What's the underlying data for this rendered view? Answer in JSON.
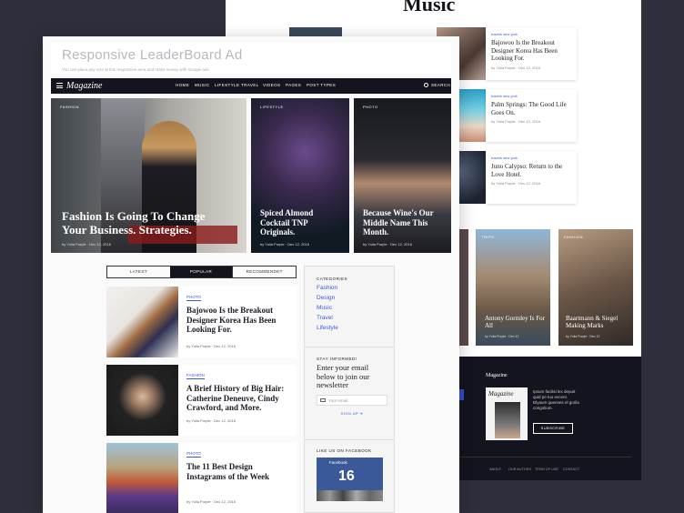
{
  "back": {
    "heading": "Music",
    "cards": [
      {
        "tag": "travels new york",
        "title": "Bajowoo Is the Breakout Designer Korea Has Been Looking For.",
        "meta": "by Yulia Purple · Dec 12, 2016"
      },
      {
        "tag": "travels new york",
        "title": "Palm Springs: The Good Life Goes On.",
        "meta": "by Yulia Purple · Dec 12, 2016"
      },
      {
        "tag": "travels new york",
        "title": "Juno Calypso: Return to the Love Hotel.",
        "meta": "by Yulia Purple · Dec 12, 2016"
      }
    ],
    "columns": [
      {
        "label": "TRIPS",
        "title": "Antony Gormley Is For All",
        "meta": "by Yulia Purple · Dec 12"
      },
      {
        "label": "FASHION",
        "title": "Baartmann & Siegel Making Marks",
        "meta": "by Yulia Purple · Dec 12"
      }
    ],
    "footer": {
      "heading": "Magazine",
      "logo": "Magazine",
      "text": "Ipsum facilisi lex depuit quid pe tuo excent. Dlyaum quennes el gorila congolium.",
      "subscribe": "SUBSCRIBE",
      "links": [
        "ABOUT",
        "OUR AUTORS",
        "TERM OF USE",
        "CONTACT"
      ]
    }
  },
  "ad": {
    "title": "Responsive LeaderBoard Ad",
    "subtitle": "You can place any size at this responsive area and make money with Google ads"
  },
  "nav": {
    "logo": "Magazine",
    "items": [
      "HOME",
      "MUSIC",
      "LIFESTYLE",
      "TRAVEL",
      "VIDEOS",
      "PAGES",
      "POST TYPES"
    ],
    "search": "SEARCH"
  },
  "hero": [
    {
      "label": "FASHION",
      "title": "Fashion Is Going To Change Your Business. Strategies.",
      "meta": "by Yulia Purple · Dec 12, 2016"
    },
    {
      "label": "LIFESTYLE",
      "title": "Spiced Almond Cocktail TNP Originals.",
      "meta": "by Yulia Purple · Dec 12, 2016"
    },
    {
      "label": "PHOTO",
      "title": "Because Wine's Our Middle Name This Month.",
      "meta": "by Yulia Purple · Dec 12, 2016"
    }
  ],
  "tabs": [
    "LATEST",
    "POPULAR",
    "RECOMMENDET"
  ],
  "articles": [
    {
      "tag": "PHOTO",
      "title": "Bajowoo Is the Breakout Designer Korea Has Been Looking For.",
      "meta": "by Yulia Purple · Dec 12, 2016"
    },
    {
      "tag": "FASHION",
      "title": "A Brief History of Big Hair: Catherine Deneuve, Cindy Crawford, and More.",
      "meta": "by Yulia Purple · Dec 12, 2016"
    },
    {
      "tag": "PHOTO",
      "title": "The 11 Best Design Instagrams of the Week",
      "meta": "by Yulia Purple · Dec 12, 2016"
    }
  ],
  "sidebar": {
    "categories_heading": "CATEGORIES",
    "categories": [
      "Fashion",
      "Design",
      "Music",
      "Travel",
      "Lifestyle"
    ],
    "newsletter_heading": "STAY INFORMED!",
    "newsletter_text": "Enter your email below to join our newsletter",
    "email_placeholder": "Your email",
    "signup": "SIGN UP ➔",
    "facebook_heading": "LIKE US ON FACEBOOK",
    "fb_page": "Facebook",
    "fb_count": "16"
  }
}
